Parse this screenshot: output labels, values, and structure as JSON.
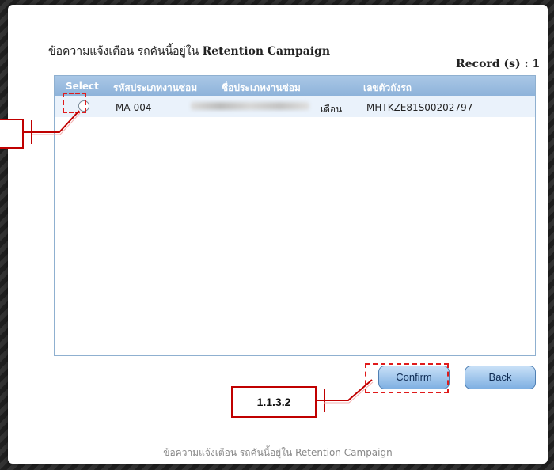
{
  "dialog": {
    "title_thai": "ข้อความแจ้งเตือน รถคันนี้อยู่ใน",
    "title_campaign": "Retention Campaign",
    "record_label": "Record (s) : 1",
    "footer": "ข้อความแจ้งเตือน รถคันนี้อยู่ใน Retention Campaign"
  },
  "grid": {
    "headers": [
      "Select",
      "รหัสประเภทงานซ่อม",
      "ชื่อประเภทงานซ่อม",
      "เลขตัวถังรถ"
    ],
    "rows": [
      {
        "selected": false,
        "code": "MA-004",
        "name_suffix": "เดือน",
        "vin": "MHTKZE81S00202797"
      }
    ]
  },
  "buttons": {
    "confirm": "Confirm",
    "back": "Back"
  },
  "annotations": {
    "callout_confirm": "1.1.3.2"
  },
  "colors": {
    "header": "#8eb3da",
    "row": "#eaf2fb",
    "annotation": "#e01b1b"
  }
}
